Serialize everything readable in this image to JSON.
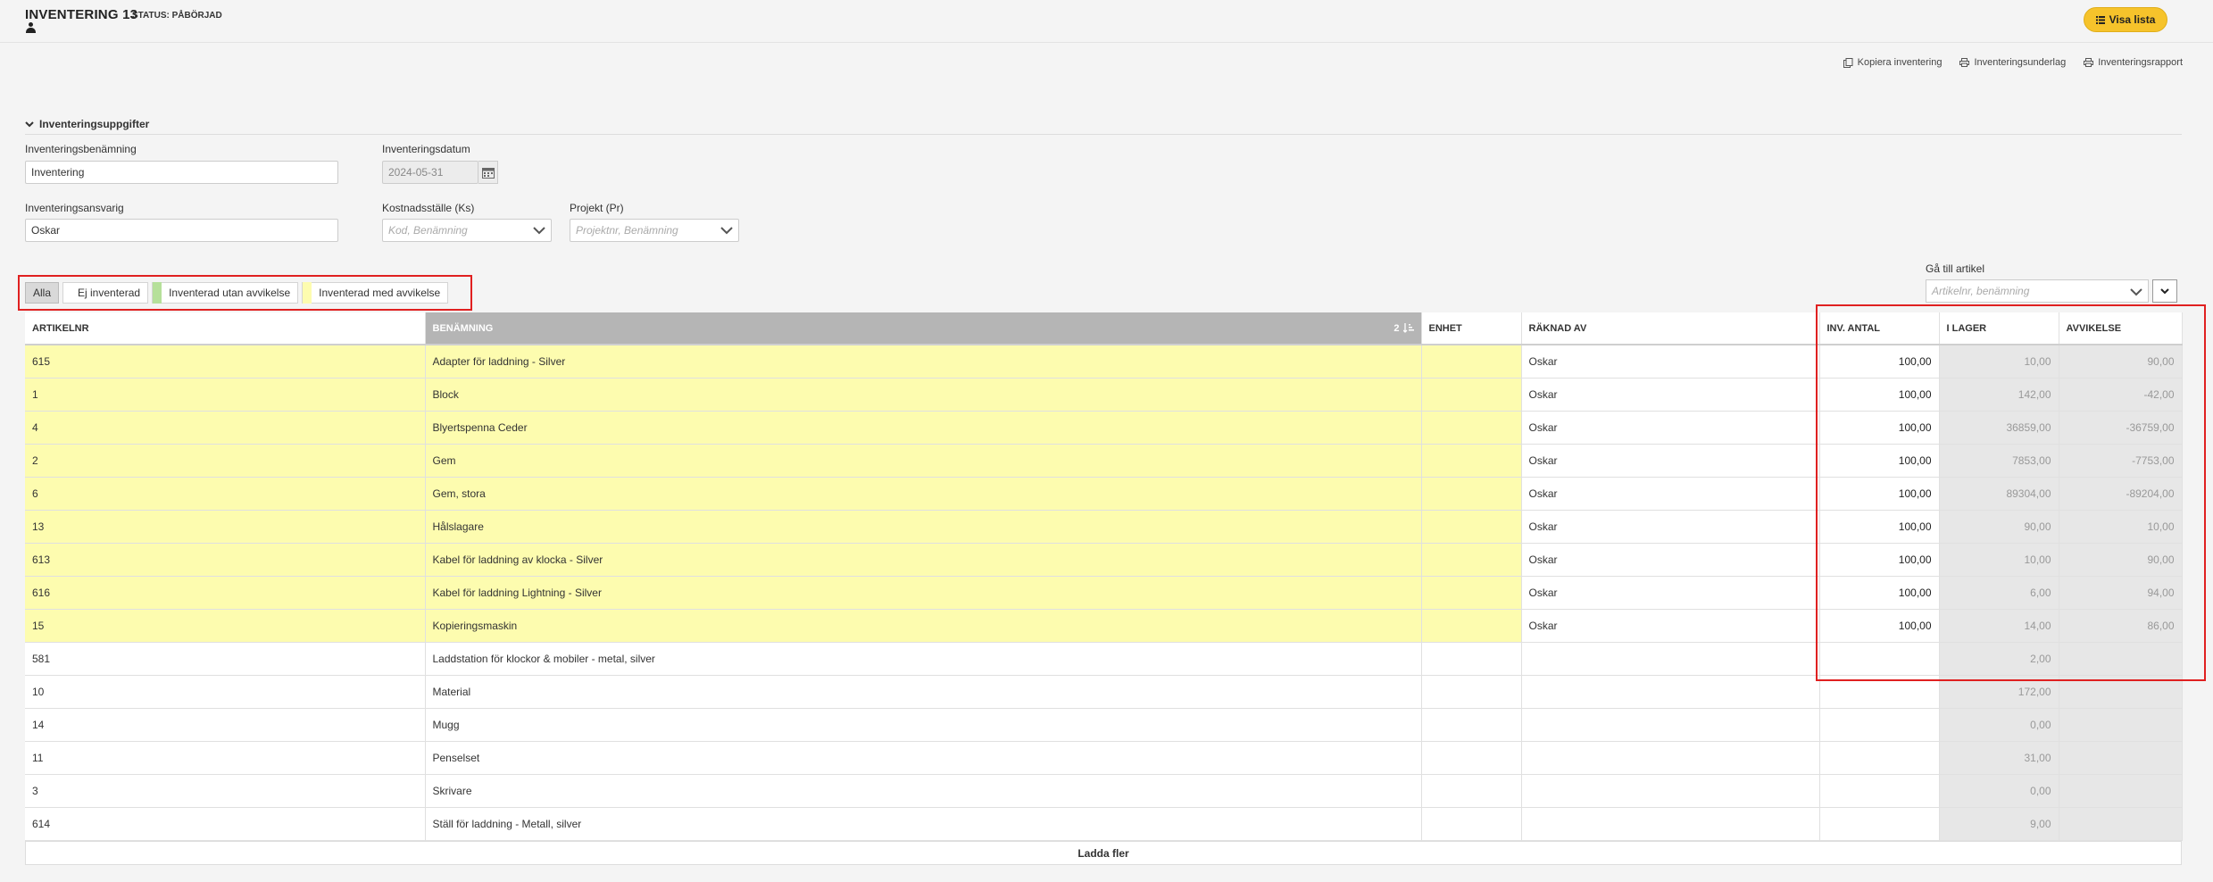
{
  "header": {
    "title": "INVENTERING 13",
    "status": "STATUS: PÅBÖRJAD",
    "visa_lista": "Visa lista"
  },
  "actions": [
    {
      "label": "Kopiera inventering",
      "icon": "copy-icon"
    },
    {
      "label": "Inventeringsunderlag",
      "icon": "print-icon"
    },
    {
      "label": "Inventeringsrapport",
      "icon": "print-icon"
    }
  ],
  "section": {
    "title": "Inventeringsuppgifter"
  },
  "form": {
    "benamning_label": "Inventeringsbenämning",
    "benamning_value": "Inventering",
    "datum_label": "Inventeringsdatum",
    "datum_value": "2024-05-31",
    "ansvarig_label": "Inventeringsansvarig",
    "ansvarig_value": "Oskar",
    "kostnadsstalle_label": "Kostnadsställe (Ks)",
    "kostnadsstalle_placeholder": "Kod, Benämning",
    "projekt_label": "Projekt (Pr)",
    "projekt_placeholder": "Projektnr, Benämning"
  },
  "filters": {
    "alla": "Alla",
    "ej_inventerad": "Ej inventerad",
    "utan_avvikelse": "Inventerad utan avvikelse",
    "med_avvikelse": "Inventerad med avvikelse",
    "colors": {
      "utan": "#b6e09a",
      "med": "#fdfcaf"
    }
  },
  "goto": {
    "label": "Gå till artikel",
    "placeholder": "Artikelnr, benämning"
  },
  "table": {
    "columns": [
      "ARTIKELNR",
      "BENÄMNING",
      "ENHET",
      "RÄKNAD AV",
      "INV. ANTAL",
      "I LAGER",
      "AVVIKELSE"
    ],
    "sort_index": "2",
    "rows": [
      {
        "nr": "615",
        "name": "Adapter för laddning - Silver",
        "enhet": "",
        "raknad": "Oskar",
        "antal": "100,00",
        "lager": "10,00",
        "avv": "90,00",
        "highlight": true
      },
      {
        "nr": "1",
        "name": "Block",
        "enhet": "",
        "raknad": "Oskar",
        "antal": "100,00",
        "lager": "142,00",
        "avv": "-42,00",
        "highlight": true
      },
      {
        "nr": "4",
        "name": "Blyertspenna Ceder",
        "enhet": "",
        "raknad": "Oskar",
        "antal": "100,00",
        "lager": "36859,00",
        "avv": "-36759,00",
        "highlight": true
      },
      {
        "nr": "2",
        "name": "Gem",
        "enhet": "",
        "raknad": "Oskar",
        "antal": "100,00",
        "lager": "7853,00",
        "avv": "-7753,00",
        "highlight": true
      },
      {
        "nr": "6",
        "name": "Gem, stora",
        "enhet": "",
        "raknad": "Oskar",
        "antal": "100,00",
        "lager": "89304,00",
        "avv": "-89204,00",
        "highlight": true
      },
      {
        "nr": "13",
        "name": "Hålslagare",
        "enhet": "",
        "raknad": "Oskar",
        "antal": "100,00",
        "lager": "90,00",
        "avv": "10,00",
        "highlight": true
      },
      {
        "nr": "613",
        "name": "Kabel för laddning av klocka - Silver",
        "enhet": "",
        "raknad": "Oskar",
        "antal": "100,00",
        "lager": "10,00",
        "avv": "90,00",
        "highlight": true
      },
      {
        "nr": "616",
        "name": "Kabel för laddning Lightning - Silver",
        "enhet": "",
        "raknad": "Oskar",
        "antal": "100,00",
        "lager": "6,00",
        "avv": "94,00",
        "highlight": true
      },
      {
        "nr": "15",
        "name": "Kopieringsmaskin",
        "enhet": "",
        "raknad": "Oskar",
        "antal": "100,00",
        "lager": "14,00",
        "avv": "86,00",
        "highlight": true
      },
      {
        "nr": "581",
        "name": "Laddstation för klockor & mobiler - metal, silver",
        "enhet": "",
        "raknad": "",
        "antal": "",
        "lager": "2,00",
        "avv": "",
        "highlight": false
      },
      {
        "nr": "10",
        "name": "Material",
        "enhet": "",
        "raknad": "",
        "antal": "",
        "lager": "172,00",
        "avv": "",
        "highlight": false
      },
      {
        "nr": "14",
        "name": "Mugg",
        "enhet": "",
        "raknad": "",
        "antal": "",
        "lager": "0,00",
        "avv": "",
        "highlight": false
      },
      {
        "nr": "11",
        "name": "Penselset",
        "enhet": "",
        "raknad": "",
        "antal": "",
        "lager": "31,00",
        "avv": "",
        "highlight": false
      },
      {
        "nr": "3",
        "name": "Skrivare",
        "enhet": "",
        "raknad": "",
        "antal": "",
        "lager": "0,00",
        "avv": "",
        "highlight": false
      },
      {
        "nr": "614",
        "name": "Ställ för laddning - Metall, silver",
        "enhet": "",
        "raknad": "",
        "antal": "",
        "lager": "9,00",
        "avv": "",
        "highlight": false
      }
    ]
  },
  "load_more": "Ladda fler"
}
